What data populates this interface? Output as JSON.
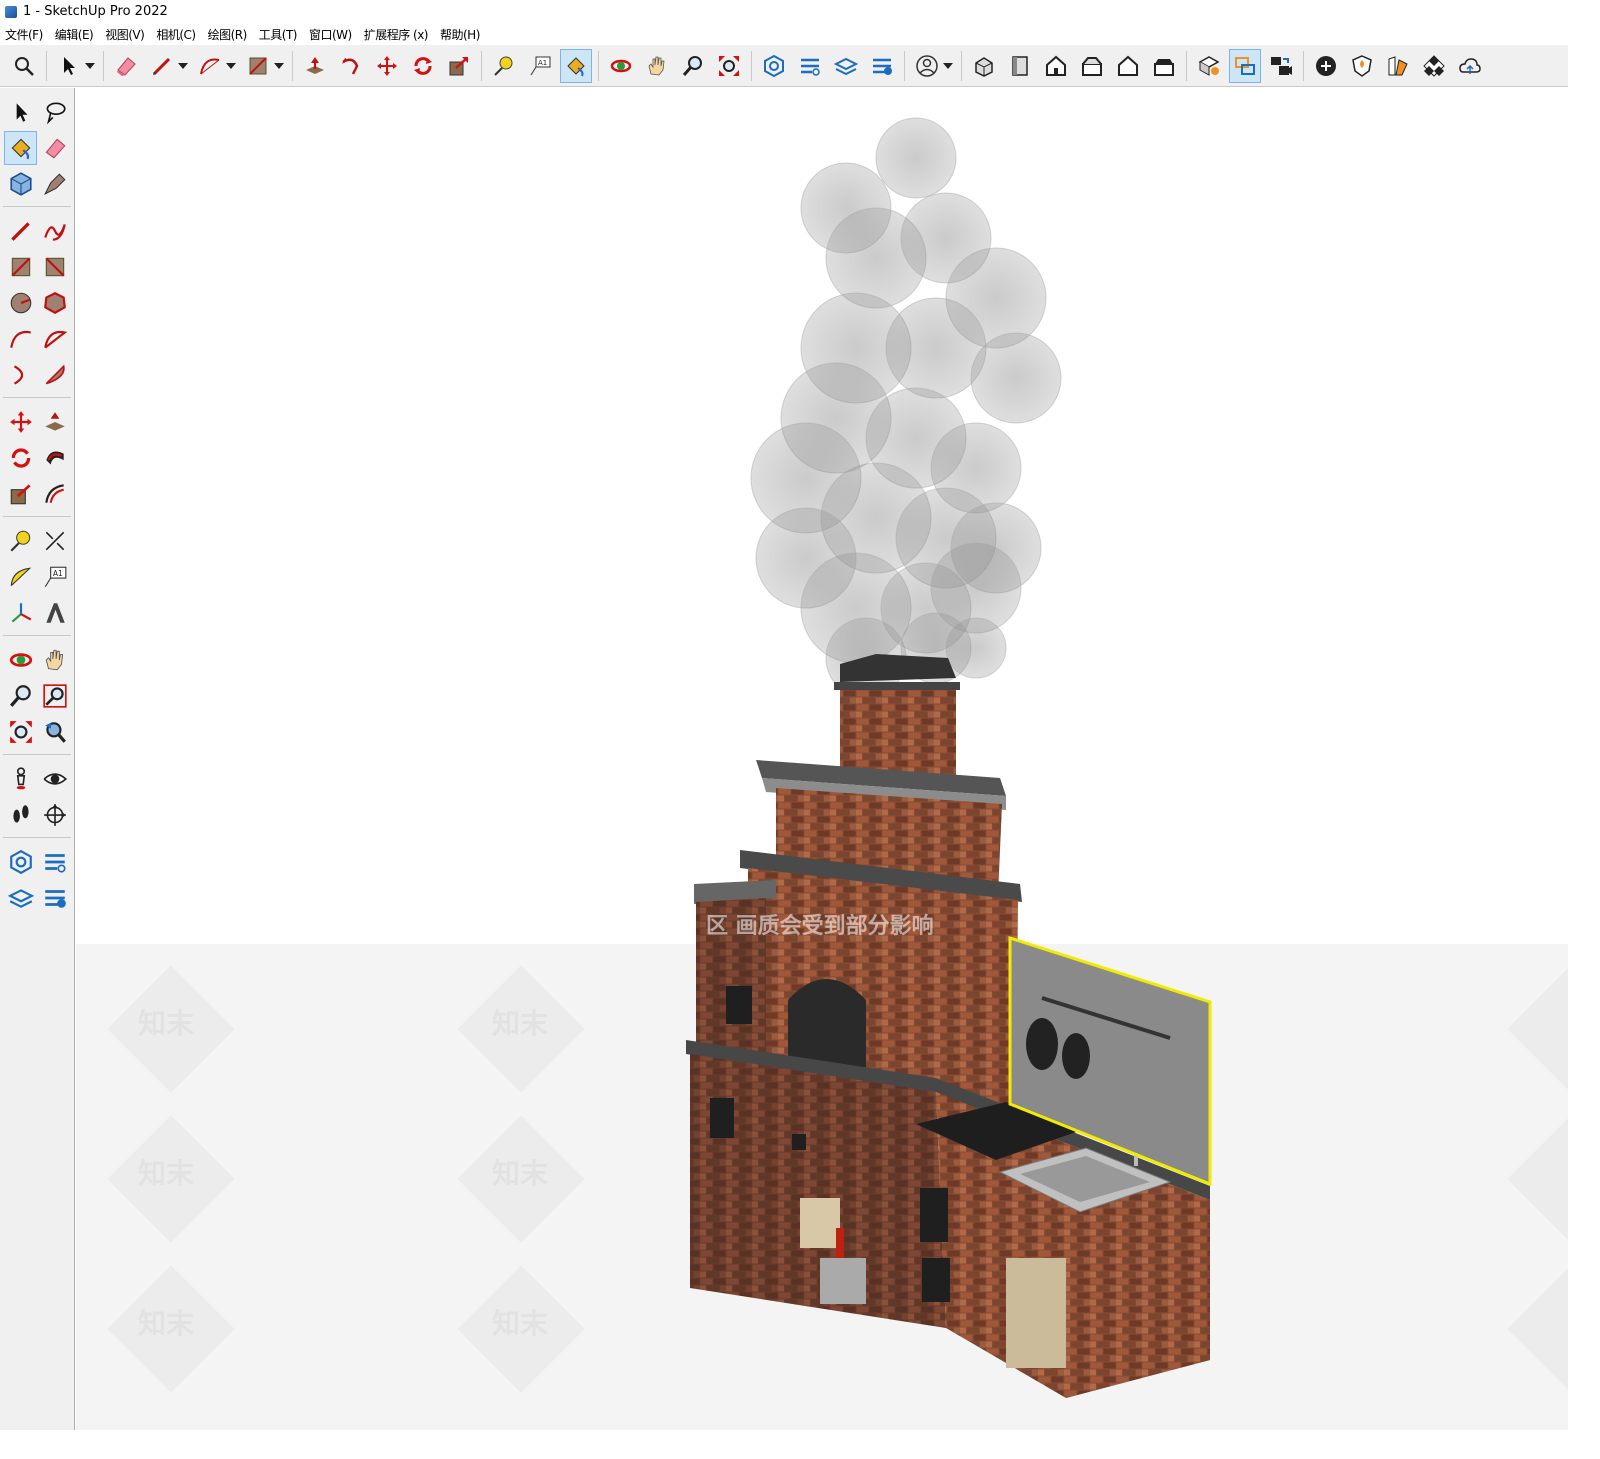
{
  "window": {
    "title": "1 - SketchUp Pro 2022"
  },
  "menu": [
    "文件(F)",
    "编辑(E)",
    "视图(V)",
    "相机(C)",
    "绘图(R)",
    "工具(T)",
    "窗口(W)",
    "扩展程序 (x)",
    "帮助(H)"
  ],
  "toolbar": {
    "icons": [
      "search-icon",
      "select-icon",
      "eraser-icon",
      "pencil-icon",
      "arc-icon",
      "rectangle-icon",
      "push-pull-icon",
      "follow-me-icon",
      "move-icon",
      "rotate-icon",
      "scale-icon",
      "tape-measure-icon",
      "text-icon",
      "paint-bucket-icon",
      "orbit-icon",
      "pan-icon",
      "zoom-icon",
      "zoom-extents-icon",
      "warehouse-icon",
      "extension-warehouse-icon",
      "layout-icon",
      "extension-manager-icon",
      "account-icon",
      "iso-view-icon",
      "top-view-icon",
      "front-view-icon",
      "right-view-icon",
      "back-view-icon",
      "left-view-icon",
      "bottom-view-icon",
      "sandbox-icon",
      "outliner-icon",
      "scenes-icon",
      "add-location-icon",
      "shadow-icon",
      "styles-icon",
      "trimble-connect-icon"
    ]
  },
  "viewport": {
    "watermark_text": "知末",
    "overlay_text": "区 画质会受到部分影响"
  },
  "colors": {
    "selection": "#f2ea00",
    "active_tool": "#cde6f7",
    "toolbar_bg": "#f0f0f0"
  }
}
